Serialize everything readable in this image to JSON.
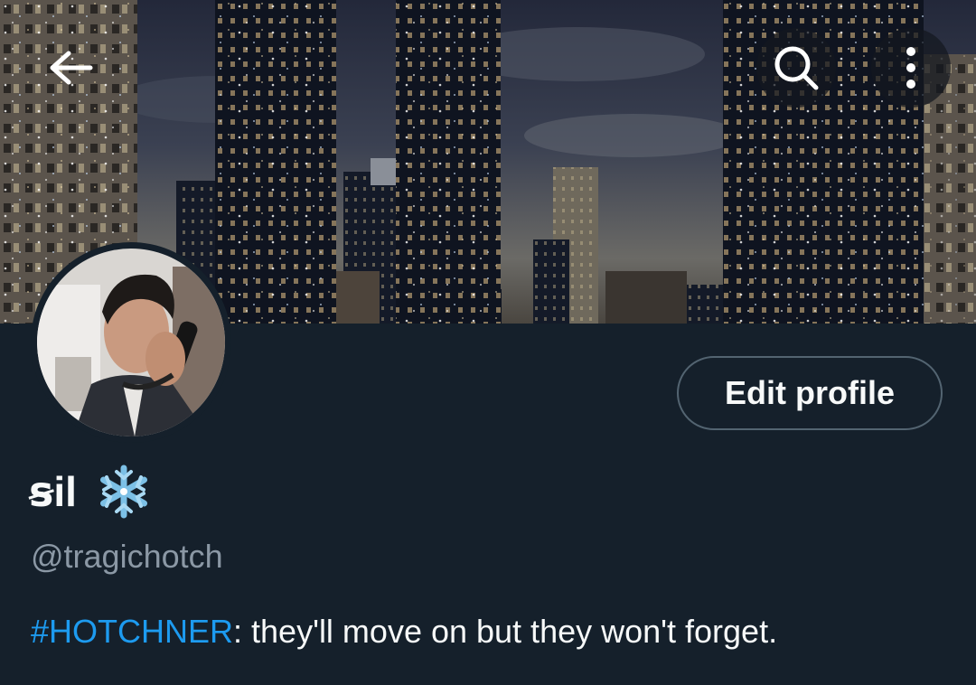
{
  "header": {
    "back_icon": "arrow-left-icon",
    "search_icon": "search-icon",
    "more_icon": "more-vertical-icon"
  },
  "profile": {
    "display_name": "ꞩil",
    "name_emoji": "snowflake-icon",
    "handle": "@tragichotch",
    "edit_button_label": "Edit profile",
    "bio": {
      "hashtag": "#HOTCHNER",
      "text": ": they'll move on but they won't forget."
    }
  },
  "colors": {
    "background": "#15202b",
    "text_primary": "#f7f9f9",
    "text_secondary": "#8b98a5",
    "accent_link": "#1d9bf0",
    "button_border": "#536471"
  }
}
